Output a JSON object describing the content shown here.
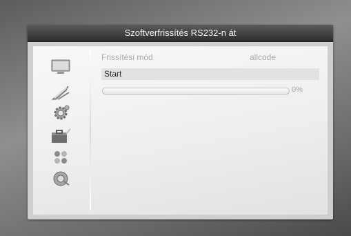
{
  "window": {
    "title": "Szoftverfrissítés RS232-n át"
  },
  "sidebar": {
    "icons": [
      "monitor-icon",
      "satellite-dish-icon",
      "settings-gear-icon",
      "toolbox-icon",
      "dots-icon",
      "disc-icon"
    ]
  },
  "menu": {
    "upgrade_mode": {
      "label": "Frissítési mód",
      "value": "allcode"
    },
    "start": {
      "label": "Start"
    }
  },
  "progress": {
    "value": 0,
    "label": "0%"
  }
}
